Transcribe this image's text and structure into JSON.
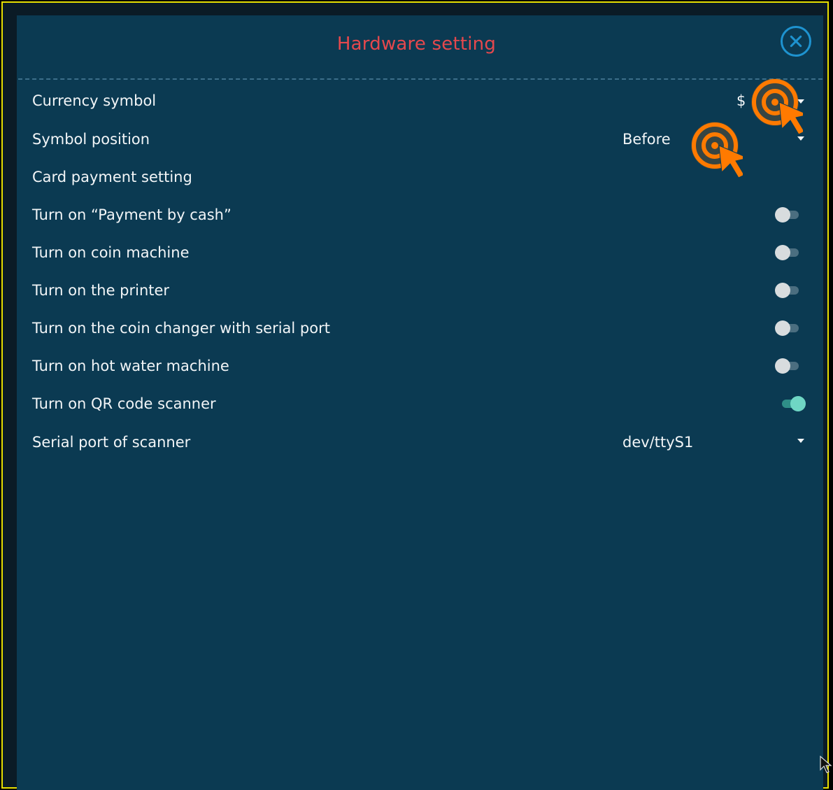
{
  "dialog": {
    "title": "Hardware setting"
  },
  "rows": {
    "currency_symbol": {
      "label": "Currency symbol",
      "value": "$"
    },
    "symbol_position": {
      "label": "Symbol position",
      "value": "Before"
    },
    "card_payment": {
      "label": "Card payment setting"
    },
    "payment_by_cash": {
      "label": "Turn on “Payment by cash”",
      "on": false
    },
    "coin_machine": {
      "label": "Turn on coin machine",
      "on": false
    },
    "printer": {
      "label": "Turn on the printer",
      "on": false
    },
    "coin_changer": {
      "label": "Turn on the coin changer with serial port",
      "on": false
    },
    "hot_water": {
      "label": "Turn on hot water machine",
      "on": false
    },
    "qr_scanner": {
      "label": "Turn on QR code scanner",
      "on": true
    },
    "serial_port": {
      "label": "Serial port of scanner",
      "value": "dev/ttyS1"
    }
  },
  "colors": {
    "title": "#e5484d",
    "accent": "#1e93d0",
    "panel": "#0b3a52",
    "toggle_on": "#6fd6c4",
    "tap_overlay": "#ff7a00"
  },
  "icons": {
    "close": "close-icon",
    "dropdown": "chevron-down-icon",
    "tap_indicator": "tap-pointer-icon",
    "mouse_cursor": "mouse-cursor-icon"
  }
}
